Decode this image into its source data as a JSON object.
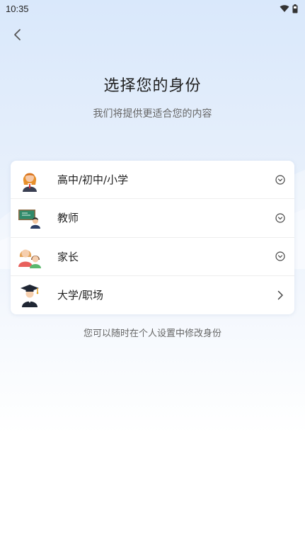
{
  "status_bar": {
    "time": "10:35",
    "wifi_icon": "wifi-icon",
    "battery_icon": "battery-icon"
  },
  "header": {
    "back_icon": "chevron-left-icon"
  },
  "title": "选择您的身份",
  "subtitle": "我们将提供更适合您的内容",
  "identities": [
    {
      "label": "高中/初中/小学",
      "icon": "student-girl-icon",
      "indicator": "expand-circle-icon"
    },
    {
      "label": "教师",
      "icon": "teacher-icon",
      "indicator": "expand-circle-icon"
    },
    {
      "label": "家长",
      "icon": "parent-child-icon",
      "indicator": "expand-circle-icon"
    },
    {
      "label": "大学/职场",
      "icon": "graduate-icon",
      "indicator": "chevron-right-icon"
    }
  ],
  "footnote": "您可以随时在个人设置中修改身份",
  "colors": {
    "background_top": "#d9e8fb",
    "card": "#ffffff",
    "text_primary": "#222222",
    "text_secondary": "#666666"
  }
}
